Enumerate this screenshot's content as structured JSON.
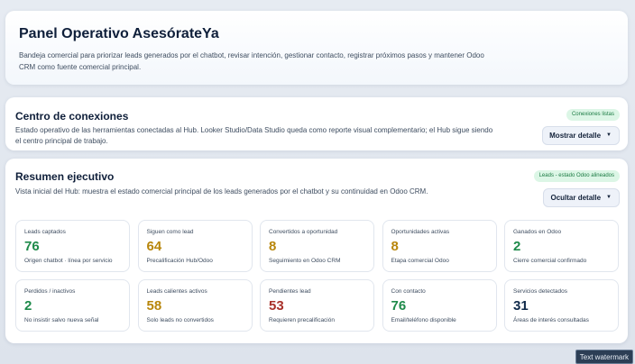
{
  "header": {
    "title": "Panel Operativo AsesórateYa",
    "description": "Bandeja comercial para priorizar leads generados por el chatbot, revisar intención, gestionar contacto, registrar próximos pasos y mantener Odoo CRM como fuente comercial principal."
  },
  "connections": {
    "title": "Centro de conexiones",
    "description": "Estado operativo de las herramientas conectadas al Hub. Looker Studio/Data Studio queda como reporte visual complementario; el Hub sigue siendo el centro principal de trabajo.",
    "badge": "Conexiones listas",
    "toggle_label": "Mostrar detalle"
  },
  "summary": {
    "title": "Resumen ejecutivo",
    "description": "Vista inicial del Hub: muestra el estado comercial principal de los leads generados por el chatbot y su continuidad en Odoo CRM.",
    "badge": "Leads - estado Odoo alineados",
    "toggle_label": "Ocultar detalle",
    "metrics": [
      {
        "label": "Leads captados",
        "value": "76",
        "sub": "Origen chatbot · línea por servicio",
        "color": "#1e8a4a"
      },
      {
        "label": "Siguen como lead",
        "value": "64",
        "sub": "Precalificación Hub/Odoo",
        "color": "#b8860b"
      },
      {
        "label": "Convertidos a oportunidad",
        "value": "8",
        "sub": "Seguimiento en Odoo CRM",
        "color": "#b8860b"
      },
      {
        "label": "Oportunidades activas",
        "value": "8",
        "sub": "Etapa comercial Odoo",
        "color": "#b8860b"
      },
      {
        "label": "Ganados en Odoo",
        "value": "2",
        "sub": "Cierre comercial confirmado",
        "color": "#1e8a4a"
      },
      {
        "label": "Perdidos / inactivos",
        "value": "2",
        "sub": "No insistir salvo nueva señal",
        "color": "#1e8a4a"
      },
      {
        "label": "Leads calientes activos",
        "value": "58",
        "sub": "Solo leads no convertidos",
        "color": "#b8860b"
      },
      {
        "label": "Pendientes lead",
        "value": "53",
        "sub": "Requieren precalificación",
        "color": "#a8312a"
      },
      {
        "label": "Con contacto",
        "value": "76",
        "sub": "Email/teléfono disponible",
        "color": "#1e8a4a"
      },
      {
        "label": "Servicios detectados",
        "value": "31",
        "sub": "Áreas de interés consultadas",
        "color": "#102a4a"
      }
    ]
  },
  "watermark": "Text watermark"
}
